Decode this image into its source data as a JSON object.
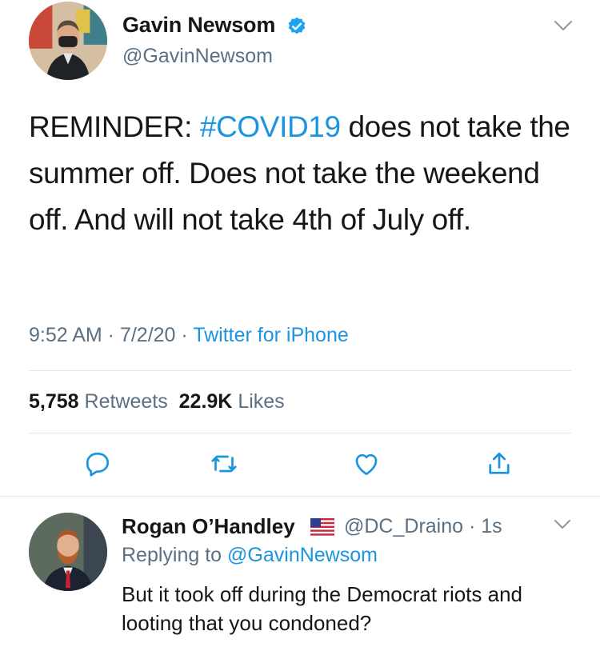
{
  "tweet": {
    "author": {
      "name": "Gavin Newsom",
      "handle": "@GavinNewsom",
      "verified": true
    },
    "text_prefix": "REMINDER: ",
    "hashtag": "#COVID19",
    "text_suffix": " does not take the summer off. Does not take the weekend off. And will not take 4th of July off.",
    "time": "9:52 AM",
    "date": "7/2/20",
    "source": "Twitter for iPhone",
    "retweets_count": "5,758",
    "retweets_label": "Retweets",
    "likes_count": "22.9K",
    "likes_label": "Likes"
  },
  "actions": [
    {
      "name": "reply-icon"
    },
    {
      "name": "retweet-icon"
    },
    {
      "name": "like-icon"
    },
    {
      "name": "share-icon"
    }
  ],
  "reply": {
    "author_name": "Rogan O’Handley",
    "handle": "@DC_Draino",
    "time_ago": "1s",
    "replying_prefix": "Replying to ",
    "replying_to": "@GavinNewsom",
    "text": "But it took off during the Democrat riots and looting that you condoned?",
    "flag_icon": "us-flag-icon"
  },
  "colors": {
    "link": "#1b95e0",
    "secondary_text": "#5b7083",
    "primary_text": "#14171a",
    "divider": "#e1e8ed"
  }
}
